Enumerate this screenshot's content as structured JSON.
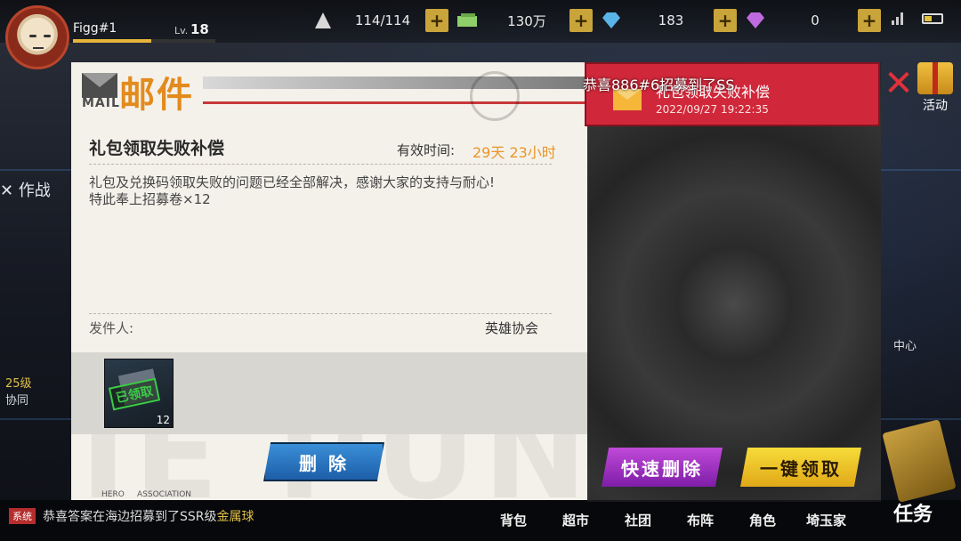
{
  "player": {
    "name": "Figg#1",
    "level_tag": "Lv.",
    "level": "18",
    "exp_fraction": 0.55
  },
  "resources": [
    {
      "icon": "stamina-icon",
      "value": "114/114",
      "color": "#d8d8d8"
    },
    {
      "icon": "cash-icon",
      "value": "130万",
      "color": "#8fcf6a"
    },
    {
      "icon": "diamond-icon",
      "value": "183",
      "color": "#5ab4e8"
    },
    {
      "icon": "purple-gem-icon",
      "value": "0",
      "color": "#c06ae0"
    }
  ],
  "plus_label": "+",
  "background": {
    "combat_label": "✕ 作战",
    "coop_level": "25级",
    "coop_label": "协同",
    "center_label": "中心",
    "activity_label": "活动",
    "bg_word": "IE PUNCH"
  },
  "mail": {
    "header_en": "MAIL",
    "header_cn": "邮件",
    "title": "礼包领取失败补偿",
    "valid_label": "有效时间:",
    "valid_value": "29天 23小时",
    "body_lines": [
      "礼包及兑换码领取失败的问题已经全部解决，感谢大家的支持与耐心!",
      "特此奉上招募卷×12"
    ],
    "sender_label": "发件人:",
    "sender_value": "英雄协会",
    "attachment": {
      "claimed_label": "已领取",
      "count": "12"
    },
    "delete_button": "删 除",
    "footer_hero": "HERO",
    "footer_assoc": "ASSOCIATION"
  },
  "mail_list": {
    "announcement": "恭喜886#6招募到了SS",
    "items": [
      {
        "title": "礼包领取失败补偿",
        "date": "2022/09/27 19:22:35"
      }
    ],
    "quick_delete_button": "快速删除",
    "claim_all_button": "一键领取"
  },
  "ticker": {
    "tag": "系统",
    "text": "恭喜答案在海边招募到了SSR级",
    "highlight": "金属球"
  },
  "bottom_nav": [
    "背包",
    "超市",
    "社团",
    "布阵",
    "角色",
    "埼玉家"
  ],
  "task_label": "任务",
  "colors": {
    "accent_orange": "#e38b1e",
    "valid_time": "#e8962a",
    "list_selected": "#d0283a",
    "claimed_green": "#3ccb48"
  }
}
